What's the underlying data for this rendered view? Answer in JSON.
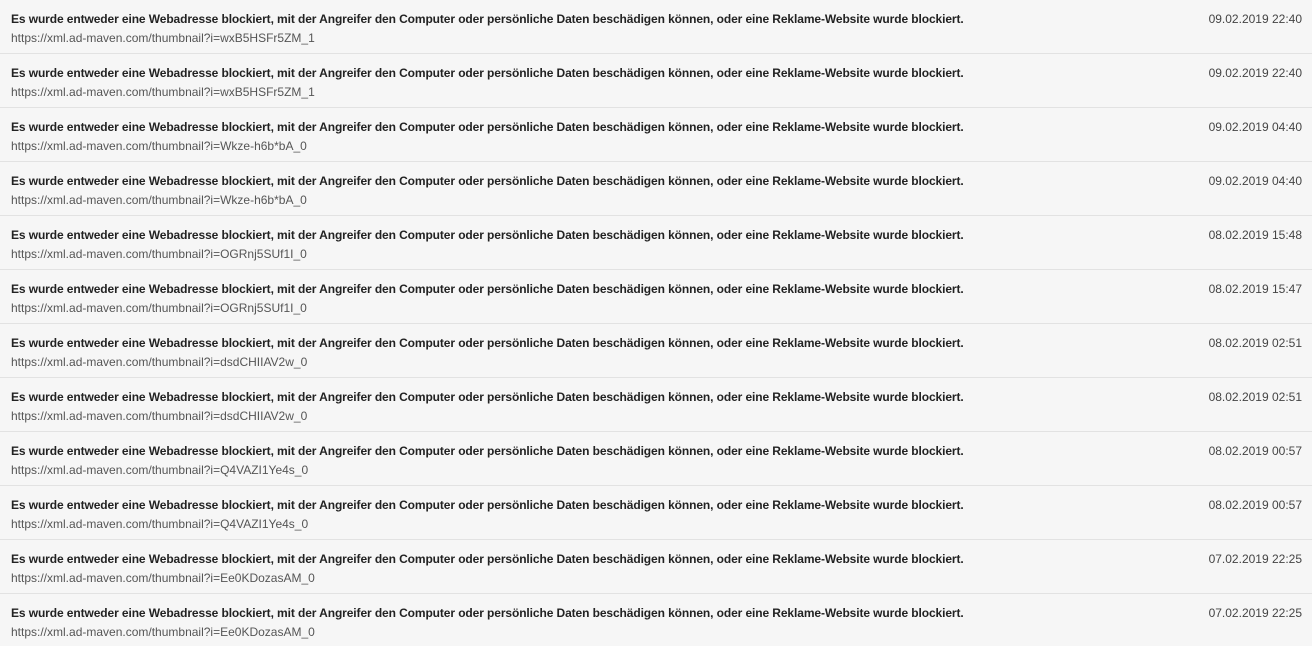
{
  "entries": [
    {
      "message": "Es wurde entweder eine Webadresse blockiert, mit der Angreifer den Computer oder persönliche Daten beschädigen können, oder eine Reklame-Website wurde blockiert.",
      "url": "https://xml.ad-maven.com/thumbnail?i=wxB5HSFr5ZM_1",
      "timestamp": "09.02.2019 22:40"
    },
    {
      "message": "Es wurde entweder eine Webadresse blockiert, mit der Angreifer den Computer oder persönliche Daten beschädigen können, oder eine Reklame-Website wurde blockiert.",
      "url": "https://xml.ad-maven.com/thumbnail?i=wxB5HSFr5ZM_1",
      "timestamp": "09.02.2019 22:40"
    },
    {
      "message": "Es wurde entweder eine Webadresse blockiert, mit der Angreifer den Computer oder persönliche Daten beschädigen können, oder eine Reklame-Website wurde blockiert.",
      "url": "https://xml.ad-maven.com/thumbnail?i=Wkze-h6b*bA_0",
      "timestamp": "09.02.2019 04:40"
    },
    {
      "message": "Es wurde entweder eine Webadresse blockiert, mit der Angreifer den Computer oder persönliche Daten beschädigen können, oder eine Reklame-Website wurde blockiert.",
      "url": "https://xml.ad-maven.com/thumbnail?i=Wkze-h6b*bA_0",
      "timestamp": "09.02.2019 04:40"
    },
    {
      "message": "Es wurde entweder eine Webadresse blockiert, mit der Angreifer den Computer oder persönliche Daten beschädigen können, oder eine Reklame-Website wurde blockiert.",
      "url": "https://xml.ad-maven.com/thumbnail?i=OGRnj5SUf1I_0",
      "timestamp": "08.02.2019 15:48"
    },
    {
      "message": "Es wurde entweder eine Webadresse blockiert, mit der Angreifer den Computer oder persönliche Daten beschädigen können, oder eine Reklame-Website wurde blockiert.",
      "url": "https://xml.ad-maven.com/thumbnail?i=OGRnj5SUf1I_0",
      "timestamp": "08.02.2019 15:47"
    },
    {
      "message": "Es wurde entweder eine Webadresse blockiert, mit der Angreifer den Computer oder persönliche Daten beschädigen können, oder eine Reklame-Website wurde blockiert.",
      "url": "https://xml.ad-maven.com/thumbnail?i=dsdCHIIAV2w_0",
      "timestamp": "08.02.2019 02:51"
    },
    {
      "message": "Es wurde entweder eine Webadresse blockiert, mit der Angreifer den Computer oder persönliche Daten beschädigen können, oder eine Reklame-Website wurde blockiert.",
      "url": "https://xml.ad-maven.com/thumbnail?i=dsdCHIIAV2w_0",
      "timestamp": "08.02.2019 02:51"
    },
    {
      "message": "Es wurde entweder eine Webadresse blockiert, mit der Angreifer den Computer oder persönliche Daten beschädigen können, oder eine Reklame-Website wurde blockiert.",
      "url": "https://xml.ad-maven.com/thumbnail?i=Q4VAZI1Ye4s_0",
      "timestamp": "08.02.2019 00:57"
    },
    {
      "message": "Es wurde entweder eine Webadresse blockiert, mit der Angreifer den Computer oder persönliche Daten beschädigen können, oder eine Reklame-Website wurde blockiert.",
      "url": "https://xml.ad-maven.com/thumbnail?i=Q4VAZI1Ye4s_0",
      "timestamp": "08.02.2019 00:57"
    },
    {
      "message": "Es wurde entweder eine Webadresse blockiert, mit der Angreifer den Computer oder persönliche Daten beschädigen können, oder eine Reklame-Website wurde blockiert.",
      "url": "https://xml.ad-maven.com/thumbnail?i=Ee0KDozasAM_0",
      "timestamp": "07.02.2019 22:25"
    },
    {
      "message": "Es wurde entweder eine Webadresse blockiert, mit der Angreifer den Computer oder persönliche Daten beschädigen können, oder eine Reklame-Website wurde blockiert.",
      "url": "https://xml.ad-maven.com/thumbnail?i=Ee0KDozasAM_0",
      "timestamp": "07.02.2019 22:25"
    }
  ]
}
